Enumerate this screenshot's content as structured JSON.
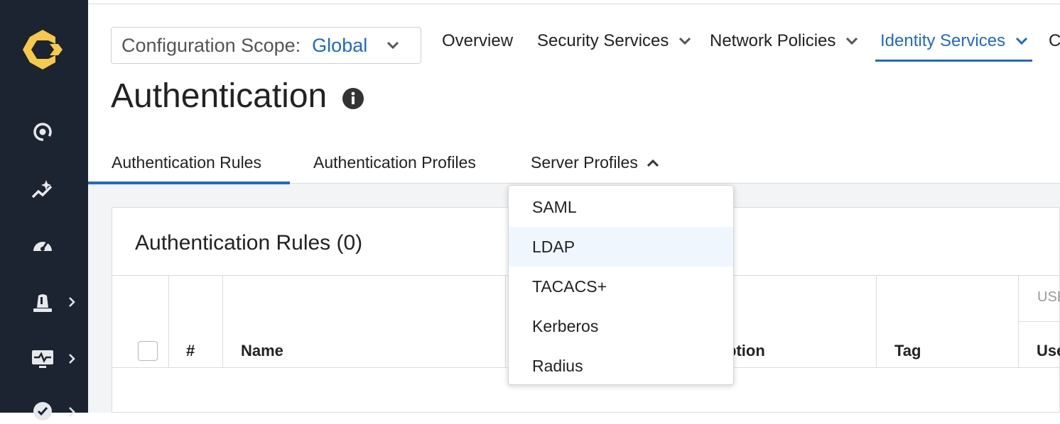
{
  "sidebar": {
    "logo": "brand-logo",
    "items": [
      {
        "icon": "radar-icon"
      },
      {
        "icon": "sparkle-chart-icon"
      },
      {
        "icon": "gauge-icon"
      },
      {
        "icon": "alarm-icon",
        "expandable": true
      },
      {
        "icon": "monitor-activity-icon",
        "expandable": true
      },
      {
        "icon": "check-shield-icon",
        "expandable": true
      }
    ]
  },
  "scope": {
    "label": "Configuration Scope:",
    "value": "Global"
  },
  "top_tabs": [
    {
      "label": "Overview"
    },
    {
      "label": "Security Services"
    },
    {
      "label": "Network Policies"
    },
    {
      "label": "Identity Services",
      "active": true
    },
    {
      "label": "C"
    }
  ],
  "page": {
    "title": "Authentication"
  },
  "sub_tabs": [
    {
      "label": "Authentication Rules",
      "active": true
    },
    {
      "label": "Authentication Profiles"
    },
    {
      "label": "Server Profiles",
      "open": true
    }
  ],
  "panel": {
    "title": "Authentication Rules (0)",
    "columns": [
      "#",
      "Name",
      "ption",
      "Tag",
      "Use"
    ],
    "group_header": "USE"
  },
  "dropdown": {
    "items": [
      "SAML",
      "LDAP",
      "TACACS+",
      "Kerberos",
      "Radius"
    ],
    "hovered": "LDAP"
  },
  "colors": {
    "accent": "#1f6ac4",
    "sidebar": "#1c2331",
    "logo": "#f7c948"
  }
}
